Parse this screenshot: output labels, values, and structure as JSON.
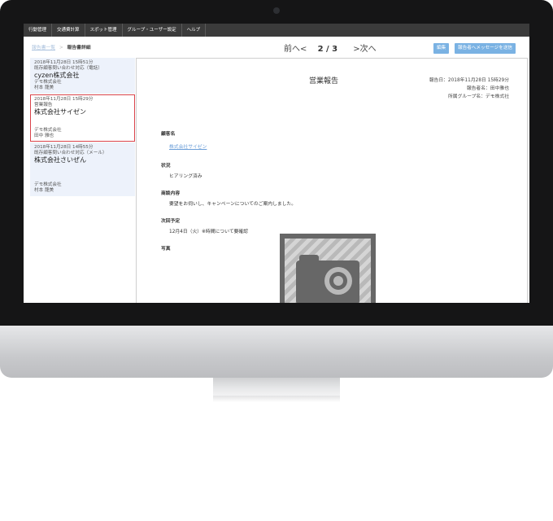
{
  "menu": {
    "items": [
      {
        "label": "行動管理"
      },
      {
        "label": "交通費計算"
      },
      {
        "label": "スポット管理"
      },
      {
        "label": "グループ・ユーザー設定"
      },
      {
        "label": "ヘルプ"
      }
    ]
  },
  "breadcrumb": {
    "parent": "報告書一覧",
    "separator": ">",
    "current": "報告書詳細"
  },
  "pager": {
    "prev": "前へ<",
    "count": "2 / 3",
    "next": ">次へ"
  },
  "buttons": {
    "edit": "編集",
    "message": "報告者へメッセージを送信"
  },
  "reports": [
    {
      "datetime": "2018年11月28日 15時51分",
      "type": "既存顧客問い合わせ対応（電話）",
      "customer": "cyzen株式会社",
      "company": "デモ株式会社",
      "person": "村本 龍美"
    },
    {
      "datetime": "2018年11月28日 15時29分",
      "type": "営業報告",
      "customer": "株式会社サイゼン",
      "company": "デモ株式会社",
      "person": "田中 雅也"
    },
    {
      "datetime": "2018年11月28日 14時55分",
      "type": "既存顧客問い合わせ対応（メール）",
      "customer": "株式会社さいぜん",
      "company": "デモ株式会社",
      "person": "村本 龍美"
    }
  ],
  "detail": {
    "title": "営業報告",
    "report_date": "報告日：2018年11月28日 15時29分",
    "reporter": "報告者名：田中雅也",
    "group": "所属グループ名：デモ株式社",
    "fields": {
      "customer_label": "顧客名",
      "customer_value": "株式会社サイゼン",
      "status_label": "状況",
      "status_value": "ヒアリング済み",
      "content_label": "商談内容",
      "content_value": "要望をお伺いし、キャンペーンについてのご案内しました。",
      "next_label": "次回予定",
      "next_value": "12月4日（火）※時間について要確認",
      "photo_label": "写真"
    }
  },
  "colors": {
    "menubar": "#3b3b3b",
    "button": "#7ab2e3",
    "selected_border": "#d9434b",
    "list_bg": "#edf2fb",
    "link": "#6b9ed8"
  }
}
